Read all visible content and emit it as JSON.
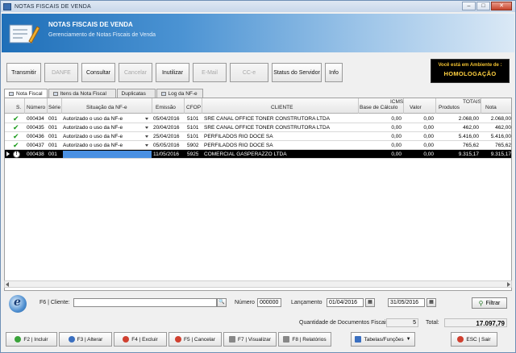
{
  "window": {
    "title": "NOTAS FISCAIS DE VENDA"
  },
  "banner": {
    "title": "NOTAS FISCAIS DE VENDA",
    "subtitle": "Gerenciamento de Notas Fiscais de Venda"
  },
  "toolbar": {
    "buttons": [
      {
        "label": "Transmitir",
        "enabled": true
      },
      {
        "label": "DANFE",
        "enabled": false
      },
      {
        "label": "Consultar",
        "enabled": true
      },
      {
        "label": "Cancelar",
        "enabled": false
      },
      {
        "label": "Inutilizar",
        "enabled": true
      },
      {
        "label": "E-Mail",
        "enabled": false
      },
      {
        "label": "CC-e",
        "enabled": false
      },
      {
        "label": "Status do Servidor",
        "enabled": true
      },
      {
        "label": "Info",
        "enabled": true
      }
    ]
  },
  "environment": {
    "line1": "Você está em Ambiente de :",
    "line2": "HOMOLOGAÇÃO"
  },
  "tabs": [
    {
      "label": "Nota Fiscal",
      "active": true
    },
    {
      "label": "Itens da Nota Fiscal",
      "active": false
    },
    {
      "label": "Duplicatas",
      "active": false
    },
    {
      "label": "Log da NF-e",
      "active": false
    }
  ],
  "grid": {
    "group_headers": {
      "icms": "ICMS",
      "totais": "TOTAIS"
    },
    "columns": {
      "s": "S.",
      "numero": "Número",
      "serie": "Série",
      "situacao": "Situação da NF-e",
      "emissao": "Emissão",
      "cfop": "CFOP",
      "cliente": "CLIENTE",
      "base": "Base de Cálculo",
      "valor": "Valor",
      "produtos": "Produtos",
      "nota": "Nota"
    },
    "rows": [
      {
        "status": "ok",
        "numero": "000434",
        "serie": "001",
        "situacao": "Autorizado o uso da NF-e",
        "emissao": "05/04/2016",
        "cfop": "5101",
        "cliente": "SRE CANAL OFFICE TONER CONSTRUTORA LTDA",
        "base": "0,00",
        "valor": "0,00",
        "produtos": "2.068,00",
        "nota": "2.068,00"
      },
      {
        "status": "ok",
        "numero": "000435",
        "serie": "001",
        "situacao": "Autorizado o uso da NF-e",
        "emissao": "20/04/2016",
        "cfop": "5101",
        "cliente": "SRE CANAL OFFICE TONER CONSTRUTORA LTDA",
        "base": "0,00",
        "valor": "0,00",
        "produtos": "462,00",
        "nota": "462,00"
      },
      {
        "status": "ok",
        "numero": "000436",
        "serie": "001",
        "situacao": "Autorizado o uso da NF-e",
        "emissao": "25/04/2016",
        "cfop": "5101",
        "cliente": "PERFILADOS RIO DOCE SA",
        "base": "0,00",
        "valor": "0,00",
        "produtos": "5.416,00",
        "nota": "5.416,00"
      },
      {
        "status": "ok",
        "numero": "000437",
        "serie": "001",
        "situacao": "Autorizado o uso da NF-e",
        "emissao": "05/05/2016",
        "cfop": "5902",
        "cliente": "PERFILADOS RIO DOCE SA",
        "base": "0,00",
        "valor": "0,00",
        "produtos": "765,62",
        "nota": "765,62"
      },
      {
        "status": "pending",
        "numero": "000438",
        "serie": "001",
        "situacao": "",
        "emissao": "11/05/2016",
        "cfop": "5925",
        "cliente": "COMERCIAL GASPERAZZO LTDA",
        "base": "0,00",
        "valor": "0,00",
        "produtos": "9.315,17",
        "nota": "9.315,17"
      }
    ]
  },
  "filter": {
    "cliente_label": "F6 | Cliente:",
    "cliente_value": "",
    "numero_label": "Número",
    "numero_value": "000000",
    "lancamento_label": "Lançamento",
    "date_from": "01/04/2016",
    "date_to": "31/05/2016",
    "filtrar_label": "Filtrar"
  },
  "totals": {
    "qtd_label": "Quantidade de Documentos Fiscais:",
    "qtd_value": "5",
    "total_label": "Total:",
    "total_value": "17.097,79"
  },
  "bottom": {
    "buttons": [
      {
        "label": "F2 | Incluir",
        "color": "#3aa33a"
      },
      {
        "label": "F3 | Alterar",
        "color": "#3a6fc0"
      },
      {
        "label": "F4 | Excluir",
        "color": "#d04030"
      },
      {
        "label": "F5 | Cancelar",
        "color": "#d04030"
      },
      {
        "label": "F7 | Visualizar",
        "color": "#888888"
      },
      {
        "label": "F8 | Relatórios",
        "color": "#888888"
      },
      {
        "label": "Tabelas/Funções",
        "color": "#3a6fc0"
      },
      {
        "label": "ESC | Sair",
        "color": "#d04030"
      }
    ]
  }
}
